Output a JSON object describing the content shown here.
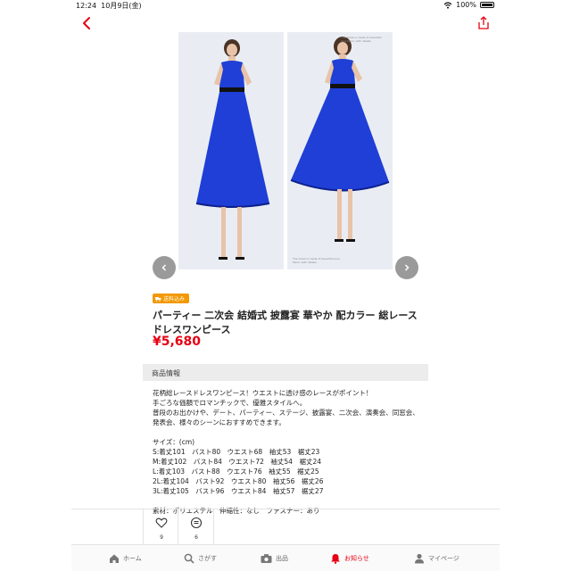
{
  "status_bar": {
    "time": "12:24",
    "date": "10月9日(金)",
    "battery": "100%"
  },
  "header": {
    "back_icon": "chevron-left-icon",
    "share_icon": "share-icon",
    "accent": "#e60012"
  },
  "gallery": {
    "caption_top": "The dress is made of beautiful lace fabric with details",
    "caption_bottom": "The dress is made of beautiful lace fabric with details",
    "dress_color": "#1f3fd6"
  },
  "product": {
    "badge": "送料込み",
    "title": "パーティー 二次会 結婚式 披露宴 華やか 配カラー 総レース ドレスワンピース",
    "price": "¥5,680"
  },
  "info": {
    "heading": "商品情報",
    "description": [
      "花柄総レースドレスワンピース！ウエストに透け感のレースがポイント！",
      "手ごろな価額でロマンチックで、優雅スタイルへ。",
      "普段のお出かけや、デート、パーティー、ステージ、披露宴、二次会、演奏会、同窓会、",
      "発表会、様々のシーンにおすすめできます。"
    ],
    "size_heading": "サイズ：(cm)",
    "sizes": [
      "S:着丈101　バスト80　ウエスト68　袖丈53　裾丈23",
      "M:着丈102　バスト84　ウエスト72　袖丈54　裾丈24",
      "L:着丈103　バスト88　ウエスト76　袖丈55　裾丈25",
      "2L:着丈104　バスト92　ウエスト80　袖丈56　裾丈26",
      "3L:着丈105　バスト96　ウエスト84　袖丈57　裾丈27"
    ],
    "material": "素材：ポリエステル　伸縮性：なし　ファスナー：あり"
  },
  "actions": {
    "likes": "9",
    "comments": "6"
  },
  "tabs": [
    {
      "label": "ホーム",
      "icon": "home-icon"
    },
    {
      "label": "さがす",
      "icon": "search-icon"
    },
    {
      "label": "出品",
      "icon": "camera-icon"
    },
    {
      "label": "お知らせ",
      "icon": "bell-icon"
    },
    {
      "label": "マイページ",
      "icon": "person-icon"
    }
  ]
}
